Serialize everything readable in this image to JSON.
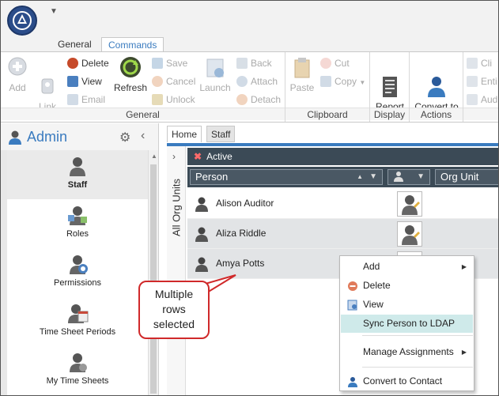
{
  "ribbon_tabs": {
    "general": "General",
    "commands": "Commands"
  },
  "ribbon": {
    "general_group": {
      "label": "General",
      "add": "Add",
      "link_to": "Link\nTo",
      "delete": "Delete",
      "view": "View",
      "email": "Email",
      "refresh": "Refresh",
      "save": "Save",
      "cancel": "Cancel",
      "unlock": "Unlock",
      "launch": "Launch",
      "back": "Back",
      "attach": "Attach",
      "detach": "Detach"
    },
    "clipboard_group": {
      "label": "Clipboard",
      "paste": "Paste",
      "cut": "Cut",
      "copy": "Copy"
    },
    "display_group": {
      "label": "Display",
      "report_mode": "Report\nMode"
    },
    "actions_group": {
      "label": "Actions",
      "convert_to_contact": "Convert to\nContact"
    },
    "extra_group": {
      "cli": "Cli",
      "enti": "Enti",
      "aud": "Aud"
    }
  },
  "left_panel": {
    "title": "Admin",
    "items": [
      {
        "label": "Staff"
      },
      {
        "label": "Roles"
      },
      {
        "label": "Permissions"
      },
      {
        "label": "Time Sheet Periods"
      },
      {
        "label": "My Time Sheets"
      }
    ]
  },
  "content_tabs": {
    "home": "Home",
    "staff": "Staff"
  },
  "vertical_strip": {
    "label": "All Org Units"
  },
  "grid": {
    "filter_bar": "Active",
    "columns": {
      "person": "Person",
      "org_unit": "Org Unit"
    },
    "rows": [
      {
        "name": "Alison Auditor",
        "selected": false
      },
      {
        "name": "Aliza Riddle",
        "selected": true
      },
      {
        "name": "Amya Potts",
        "selected": true
      }
    ]
  },
  "callout": {
    "line1": "Multiple",
    "line2": "rows",
    "line3": "selected"
  },
  "context_menu": {
    "items": [
      {
        "label": "Add"
      },
      {
        "label": "Delete"
      },
      {
        "label": "View"
      },
      {
        "label": "Sync Person to LDAP"
      },
      {
        "label": "Manage Assignments"
      },
      {
        "label": "Convert to Contact"
      }
    ]
  },
  "colors": {
    "accent": "#3a7bbf",
    "header_dark": "#3b4a56",
    "highlight": "#cfeaea",
    "callout_border": "#d0292a"
  }
}
